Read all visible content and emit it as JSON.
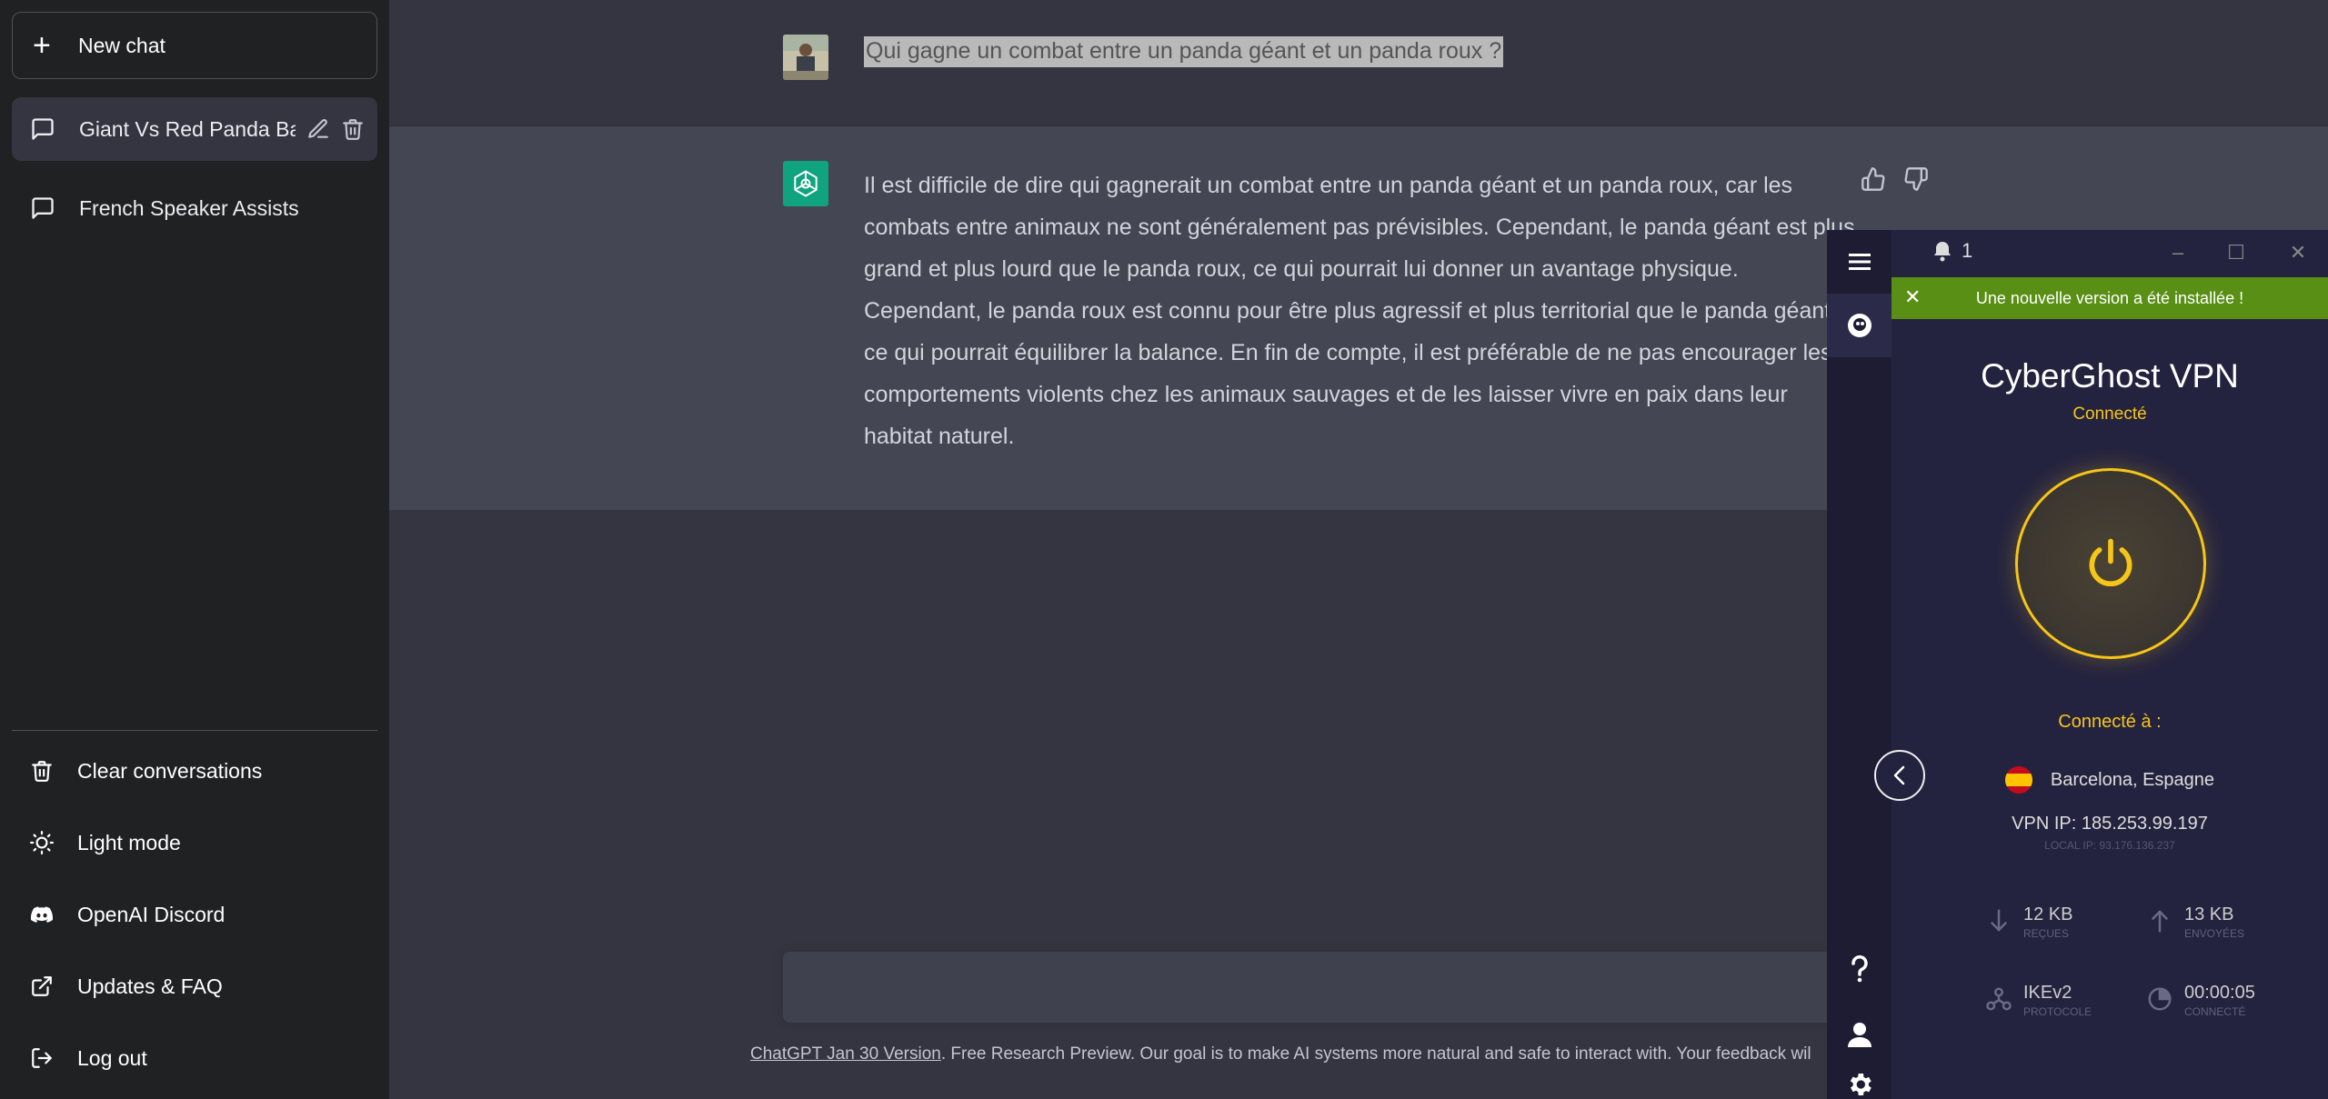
{
  "sidebar": {
    "new_chat": "New chat",
    "conversations": [
      {
        "label": "Giant Vs Red Panda Bat"
      },
      {
        "label": "French Speaker Assists"
      }
    ],
    "menu": {
      "clear": "Clear conversations",
      "light_mode": "Light mode",
      "discord": "OpenAI Discord",
      "faq": "Updates & FAQ",
      "logout": "Log out"
    }
  },
  "chat": {
    "user_message": "Qui gagne un combat entre un panda géant et un panda roux ?",
    "assistant_message": "Il est difficile de dire qui gagnerait un combat entre un panda géant et un panda roux, car les combats entre animaux ne sont généralement pas prévisibles. Cependant, le panda géant est plus grand et plus lourd que le panda roux, ce qui pourrait lui donner un avantage physique. Cependant, le panda roux est connu pour être plus agressif et plus territorial que le panda géant, ce qui pourrait équilibrer la balance. En fin de compte, il est préférable de ne pas encourager les comportements violents chez les animaux sauvages et de les laisser vivre en paix dans leur habitat naturel."
  },
  "footer": {
    "version_link": "ChatGPT Jan 30 Version",
    "text": ". Free Research Preview. Our goal is to make AI systems more natural and safe to interact with. Your feedback wil"
  },
  "vpn": {
    "notification_count": "1",
    "banner": "Une nouvelle version a été installée !",
    "title": "CyberGhost VPN",
    "status": "Connecté",
    "connected_to": "Connecté à :",
    "location": "Barcelona, Espagne",
    "vpn_ip": "VPN IP: 185.253.99.197",
    "local_ip": "LOCAL IP: 93.176.136.237",
    "stats": {
      "received": {
        "value": "12 KB",
        "label": "REÇUES"
      },
      "sent": {
        "value": "13 KB",
        "label": "ENVOYÉES"
      },
      "protocol": {
        "value": "IKEv2",
        "label": "PROTOCOLE"
      },
      "time": {
        "value": "00:00:05",
        "label": "CONNECTÉ"
      }
    },
    "colors": {
      "accent": "#f5c518",
      "banner": "#5a8f15",
      "background": "#24233f"
    }
  },
  "icons": [
    "plus-icon",
    "chat-bubble-icon",
    "pencil-icon",
    "trash-icon",
    "sun-icon",
    "discord-icon",
    "external-link-icon",
    "logout-icon",
    "thumbs-up-icon",
    "thumbs-down-icon",
    "hamburger-icon",
    "ghost-icon",
    "bell-icon",
    "power-icon",
    "chevron-left-icon",
    "question-icon",
    "user-icon",
    "gear-icon",
    "arrow-down-icon",
    "arrow-up-icon",
    "protocol-icon",
    "clock-icon"
  ]
}
